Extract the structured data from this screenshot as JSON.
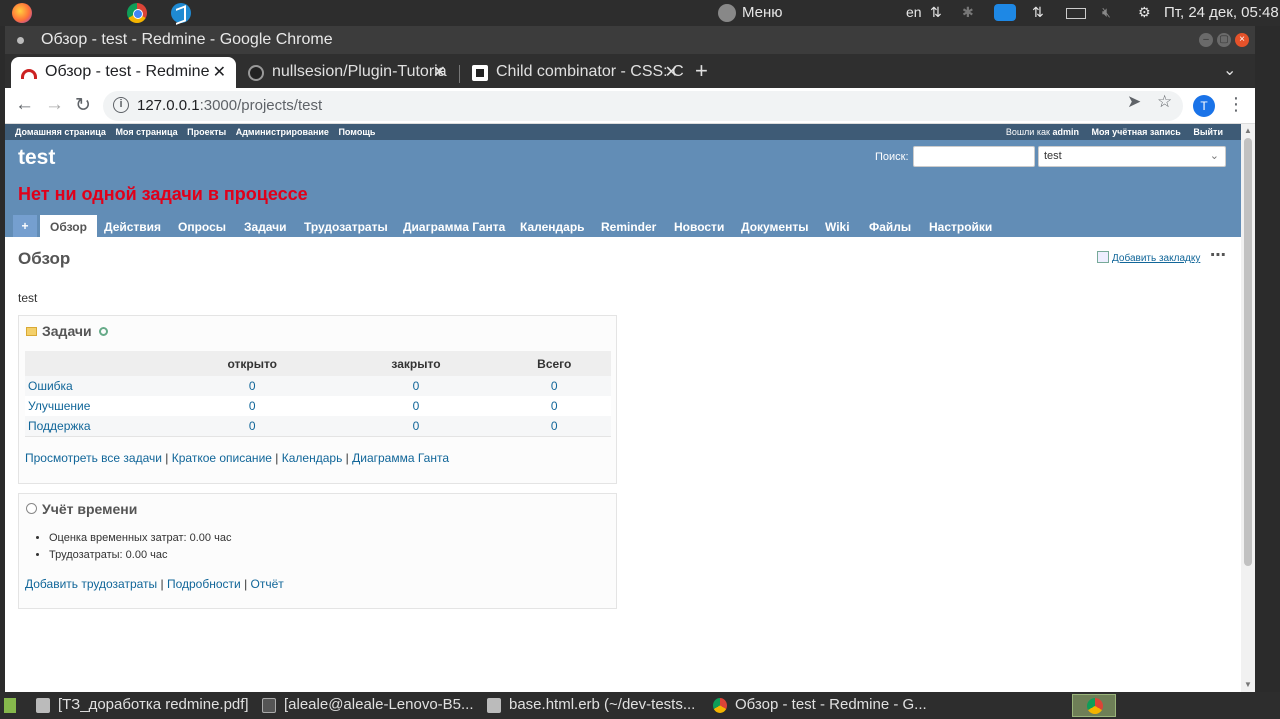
{
  "system": {
    "menu_label": "Меню",
    "lang": "en",
    "clock": "Пт, 24 дек, 05:48"
  },
  "window": {
    "title": "Обзор - test - Redmine - Google Chrome"
  },
  "tabs": [
    {
      "label": "Обзор - test - Redmine",
      "active": true
    },
    {
      "label": "nullsesion/Plugin-Tutoria",
      "active": false
    },
    {
      "label": "Child combinator - CSS: C",
      "active": false
    }
  ],
  "omnibox": {
    "host": "127.0.0.1",
    "rest": ":3000/projects/test",
    "avatar_letter": "T"
  },
  "redmine": {
    "top_menu": [
      "Домашняя страница",
      "Моя страница",
      "Проекты",
      "Администрирование",
      "Помощь"
    ],
    "logged_in_prefix": "Вошли как",
    "user": "admin",
    "my_account": "Моя учётная запись",
    "logout": "Выйти",
    "project_title": "test",
    "warning": "Нет ни одной задачи в процессе",
    "search_label": "Поиск:",
    "project_select": "test",
    "main_menu": [
      "+",
      "Обзор",
      "Действия",
      "Опросы",
      "Задачи",
      "Трудозатраты",
      "Диаграмма Ганта",
      "Календарь",
      "Reminder",
      "Новости",
      "Документы",
      "Wiki",
      "Файлы",
      "Настройки"
    ],
    "page_title": "Обзор",
    "bookmark": "Добавить закладку",
    "description": "test",
    "issues_box": {
      "title": "Задачи",
      "columns": [
        "",
        "открыто",
        "закрыто",
        "Всего"
      ],
      "rows": [
        {
          "name": "Ошибка",
          "open": "0",
          "closed": "0",
          "total": "0"
        },
        {
          "name": "Улучшение",
          "open": "0",
          "closed": "0",
          "total": "0"
        },
        {
          "name": "Поддержка",
          "open": "0",
          "closed": "0",
          "total": "0"
        }
      ],
      "links": [
        "Просмотреть все задачи",
        "Краткое описание",
        "Календарь",
        "Диаграмма Ганта"
      ]
    },
    "time_box": {
      "title": "Учёт времени",
      "items": [
        "Оценка временных затрат: 0.00 час",
        "Трудозатраты: 0.00 час"
      ],
      "links": [
        "Добавить трудозатраты",
        "Подробности",
        "Отчёт"
      ]
    }
  },
  "taskbar": [
    "[ТЗ_доработка redmine.pdf]",
    "[aleale@aleale-Lenovo-B5...",
    "base.html.erb (~/dev-tests...",
    "Обзор - test - Redmine - G..."
  ]
}
